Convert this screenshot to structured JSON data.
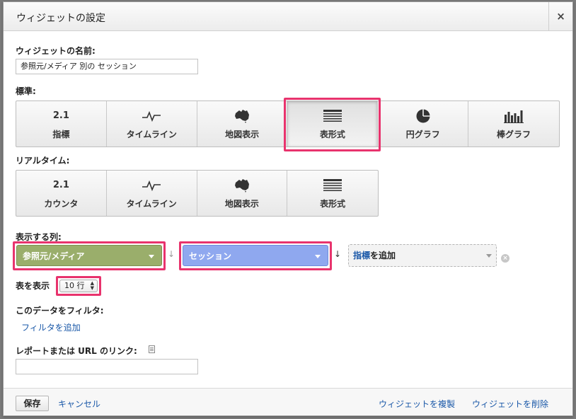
{
  "dialog": {
    "title": "ウィジェットの設定",
    "close_label": "×"
  },
  "widget_name": {
    "label": "ウィジェットの名前:",
    "value": "参照元/メディア 別の セッション"
  },
  "standard": {
    "label": "標準:",
    "tiles": [
      {
        "icon_text": "2.1",
        "label": "指標",
        "icon": "metric-icon"
      },
      {
        "icon_text": "",
        "label": "タイムライン",
        "icon": "timeline-icon"
      },
      {
        "icon_text": "",
        "label": "地図表示",
        "icon": "map-icon"
      },
      {
        "icon_text": "",
        "label": "表形式",
        "icon": "table-icon",
        "selected": true
      },
      {
        "icon_text": "",
        "label": "円グラフ",
        "icon": "pie-icon"
      },
      {
        "icon_text": "",
        "label": "棒グラフ",
        "icon": "bar-chart-icon"
      }
    ]
  },
  "realtime": {
    "label": "リアルタイム:",
    "tiles": [
      {
        "icon_text": "2.1",
        "label": "カウンタ",
        "icon": "counter-icon"
      },
      {
        "icon_text": "",
        "label": "タイムライン",
        "icon": "timeline-icon"
      },
      {
        "icon_text": "",
        "label": "地図表示",
        "icon": "map-icon"
      },
      {
        "icon_text": "",
        "label": "表形式",
        "icon": "table-icon"
      }
    ]
  },
  "columns": {
    "label": "表示する列:",
    "dimension": {
      "label": "参照元/メディア",
      "color": "#9aae6b"
    },
    "metric": {
      "label": "セッション",
      "color": "#8fa8ef"
    },
    "add_metric_blue": "指標",
    "add_metric_rest": "を追加",
    "remove_label": "×"
  },
  "show_table": {
    "label": "表を表示",
    "value": "10 行"
  },
  "filter": {
    "label": "このデータをフィルタ:",
    "add_link": "フィルタを追加"
  },
  "report_link": {
    "label": "レポートまたは URL のリンク:",
    "value": ""
  },
  "footer": {
    "save": "保存",
    "cancel": "キャンセル",
    "duplicate": "ウィジェットを複製",
    "delete": "ウィジェットを削除"
  },
  "colors": {
    "highlight": "#e8336d",
    "link": "#1a58a8"
  }
}
